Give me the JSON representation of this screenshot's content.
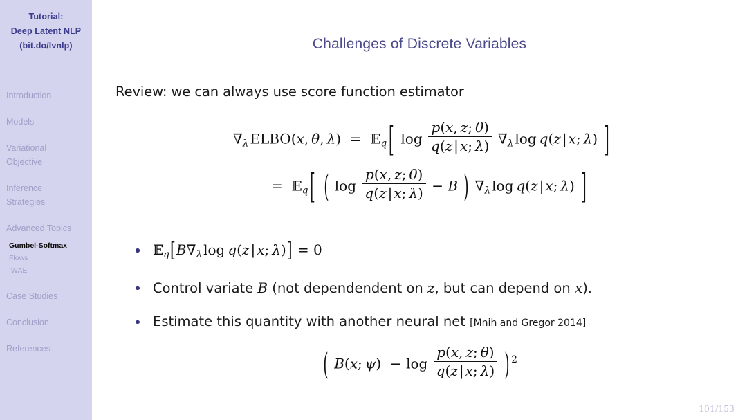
{
  "sidebar": {
    "title_lines": [
      "Tutorial:",
      "Deep Latent NLP",
      "(bit.do/lvnlp)"
    ],
    "bg_color": "#d4d4ef",
    "inactive_color": "#a0a0c8",
    "active_color": "#0a0a0a",
    "title_color": "#3c3c8c",
    "sections": [
      {
        "lines": [
          "Introduction"
        ]
      },
      {
        "lines": [
          "Models"
        ]
      },
      {
        "lines": [
          "Variational",
          "Objective"
        ]
      },
      {
        "lines": [
          "Inference",
          "Strategies"
        ]
      },
      {
        "lines": [
          "Advanced Topics"
        ]
      }
    ],
    "subsections": [
      {
        "label": "Gumbel-Softmax",
        "active": true
      },
      {
        "label": "Flows",
        "active": false
      },
      {
        "label": "IWAE",
        "active": false
      }
    ],
    "sections_after": [
      {
        "lines": [
          "Case Studies"
        ]
      },
      {
        "lines": [
          "Conclusion"
        ]
      },
      {
        "lines": [
          "References"
        ]
      }
    ]
  },
  "main": {
    "title": "Challenges of Discrete Variables",
    "title_color": "#4a4a8c",
    "review_line": "Review: we can always use score function estimator",
    "equation_line1_text": "∇λ ELBO(x, θ, λ) = E_q[ log p(x,z;θ)/q(z|x;λ) ∇λ log q(z|x;λ) ]",
    "equation_line2_text": "= E_q[ ( log p(x,z;θ)/q(z|x;λ) − B ) ∇λ log q(z|x;λ) ]",
    "bullets": [
      {
        "id": "bullet-expectation-zero",
        "text_math": "E_q[ B ∇λ log q(z|x;λ) ] = 0",
        "citation": ""
      },
      {
        "id": "bullet-control-variate",
        "text_plain_1": "Control variate ",
        "var": "B",
        "text_plain_2": " (not dependendent on ",
        "var2": "z",
        "text_plain_3": ", but can depend on ",
        "var3": "x",
        "text_plain_4": ").",
        "citation": ""
      },
      {
        "id": "bullet-estimate-neural-net",
        "text_plain": "Estimate this quantity with another neural net",
        "citation": "[Mnih and Gregor 2014]"
      }
    ],
    "equation_bottom_text": "( B(x; ψ) − log p(x,z;θ)/q(z|x;λ) )^2",
    "bullet_dot_color": "#36367f"
  },
  "footer": {
    "page_number": "101/153",
    "page_number_color": "#c2c2dc"
  },
  "math_symbols": {
    "nabla": "∇",
    "lambda": "λ",
    "theta": "θ",
    "psi": "ψ",
    "blackboard_e": "𝔼",
    "minus": "−",
    "equals": "=",
    "mid": "|"
  }
}
